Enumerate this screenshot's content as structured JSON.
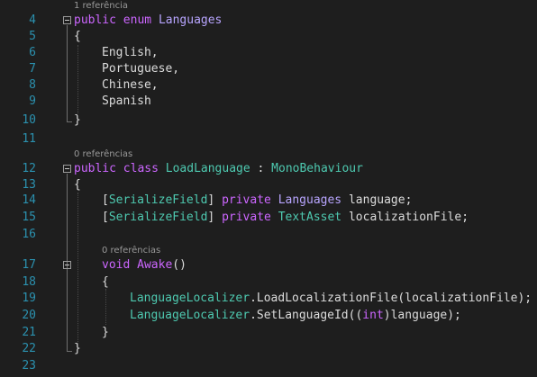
{
  "line_numbers": [
    "4",
    "5",
    "6",
    "7",
    "8",
    "9",
    "10",
    "11",
    "12",
    "13",
    "14",
    "15",
    "16",
    "17",
    "18",
    "19",
    "20",
    "21",
    "22",
    "23"
  ],
  "codelens": {
    "enum": "1 referência",
    "class": "0 referências",
    "awake": "0 referências"
  },
  "code": {
    "l4": {
      "kw1": "public",
      "kw2": "enum",
      "name": "Languages"
    },
    "l5": "{",
    "l6": "English,",
    "l7": "Portuguese,",
    "l8": "Chinese,",
    "l9": "Spanish",
    "l10": "}",
    "l12": {
      "kw1": "public",
      "kw2": "class",
      "name": "LoadLanguage",
      "sep": " : ",
      "base": "MonoBehaviour"
    },
    "l13": "{",
    "l14": {
      "b1": "[",
      "attr": "SerializeField",
      "b2": "]",
      "kw": "private",
      "type": "Languages",
      "rest": " language;"
    },
    "l15": {
      "b1": "[",
      "attr": "SerializeField",
      "b2": "]",
      "kw": "private",
      "type": "TextAsset",
      "rest": " localizationFile;"
    },
    "l17": {
      "kw": "void",
      "name": "Awake",
      "rest": "()"
    },
    "l18": "{",
    "l19": {
      "cls": "LanguageLocalizer",
      "rest": ".LoadLocalizationFile(localizationFile);"
    },
    "l20": {
      "cls": "LanguageLocalizer",
      "mid": ".SetLanguageId((",
      "kw": "int",
      "rest": ")language);"
    },
    "l21": "}",
    "l22": "}"
  },
  "colors": {
    "background": "#1e1e1e",
    "line_number": "#2b91af",
    "keyword": "#cc66ff",
    "type": "#4ec9b0",
    "enum_type": "#b8a5ff",
    "text": "#dcdcdc",
    "codelens": "#999999"
  }
}
